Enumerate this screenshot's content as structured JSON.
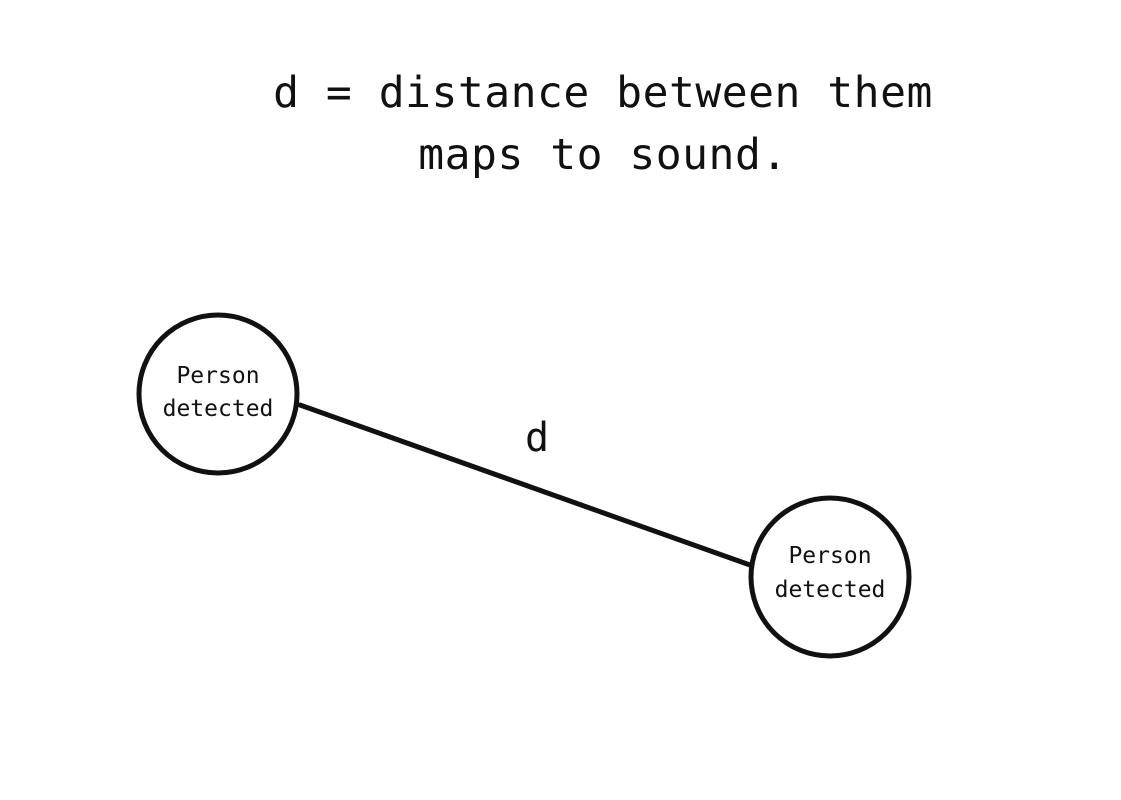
{
  "caption": {
    "line1": "d = distance between them",
    "line2": "maps to sound."
  },
  "nodes": [
    {
      "line1": "Person",
      "line2": "detected"
    },
    {
      "line1": "Person",
      "line2": "detected"
    }
  ],
  "edge": {
    "label": "d"
  },
  "colors": {
    "ink": "#111111",
    "background": "#ffffff"
  }
}
